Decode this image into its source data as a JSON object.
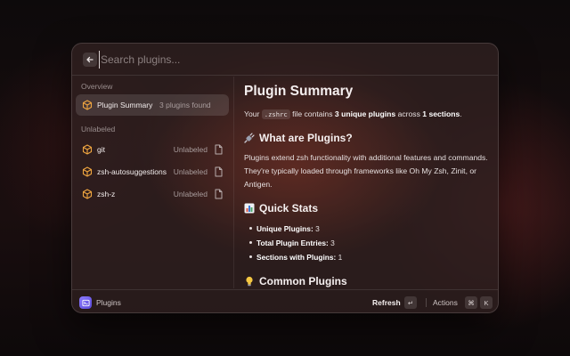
{
  "search": {
    "placeholder": "Search plugins..."
  },
  "sidebar": {
    "sections": [
      {
        "label": "Overview",
        "items": [
          {
            "title": "Plugin Summary",
            "subtitle": "3 plugins found",
            "selected": true
          }
        ]
      },
      {
        "label": "Unlabeled",
        "items": [
          {
            "title": "git",
            "tag": "Unlabeled"
          },
          {
            "title": "zsh-autosuggestions",
            "tag": "Unlabeled"
          },
          {
            "title": "zsh-z",
            "tag": "Unlabeled"
          }
        ]
      }
    ]
  },
  "detail": {
    "title": "Plugin Summary",
    "intro": {
      "prefix": "Your",
      "file": ".zshrc",
      "middle": "file contains",
      "count_bold": "3 unique plugins",
      "across": "across",
      "sections_bold": "1 sections",
      "end": "."
    },
    "what_heading": "What are Plugins?",
    "what_text": "Plugins extend zsh functionality with additional features and commands. They're typically loaded through frameworks like Oh My Zsh, Zinit, or Antigen.",
    "stats_heading": "Quick Stats",
    "stats": [
      {
        "label": "Unique Plugins:",
        "value": "3"
      },
      {
        "label": "Total Plugin Entries:",
        "value": "3"
      },
      {
        "label": "Sections with Plugins:",
        "value": "1"
      }
    ],
    "common_heading": "Common Plugins"
  },
  "footer": {
    "title": "Plugins",
    "primary_action": "Refresh",
    "primary_key": "↵",
    "actions_label": "Actions",
    "actions_keys": [
      "⌘",
      "K"
    ]
  },
  "colors": {
    "accent_icon": "#f0a640",
    "app_icon": "#7a68f0"
  }
}
